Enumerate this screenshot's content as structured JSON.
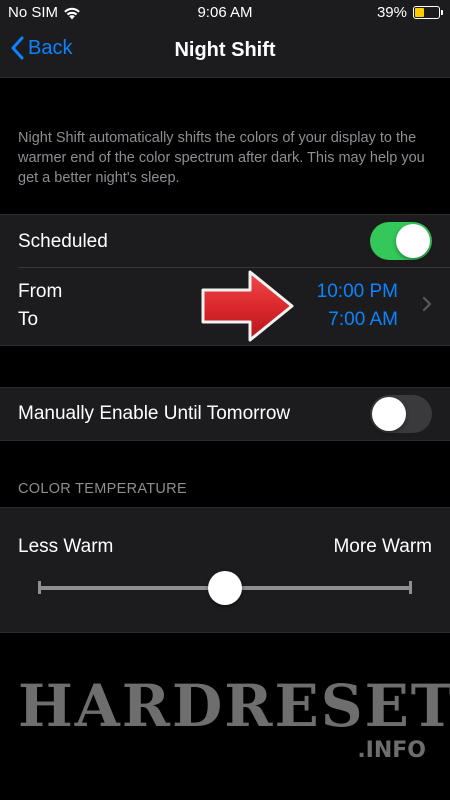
{
  "status_bar": {
    "carrier": "No SIM",
    "time": "9:06 AM",
    "battery": "39%",
    "battery_fill_fraction": 0.39,
    "battery_color": "#ffcc00"
  },
  "nav": {
    "back_label": "Back",
    "title": "Night Shift"
  },
  "description": "Night Shift automatically shifts the colors of your display to the warmer end of the color spectrum after dark. This may help you get a better night's sleep.",
  "scheduled": {
    "label": "Scheduled",
    "enabled": true,
    "from_label": "From",
    "to_label": "To",
    "from_time": "10:00 PM",
    "to_time": "7:00 AM"
  },
  "manual": {
    "label": "Manually Enable Until Tomorrow",
    "enabled": false
  },
  "color_temperature": {
    "header": "COLOR TEMPERATURE",
    "less_label": "Less Warm",
    "more_label": "More Warm",
    "value_fraction": 0.5
  },
  "watermark": {
    "main": "HARDRESET",
    "sub": ".INFO"
  },
  "colors": {
    "accent": "#0a84ff",
    "toggle_on": "#34c759",
    "annotation_arrow": "#d9262a"
  }
}
